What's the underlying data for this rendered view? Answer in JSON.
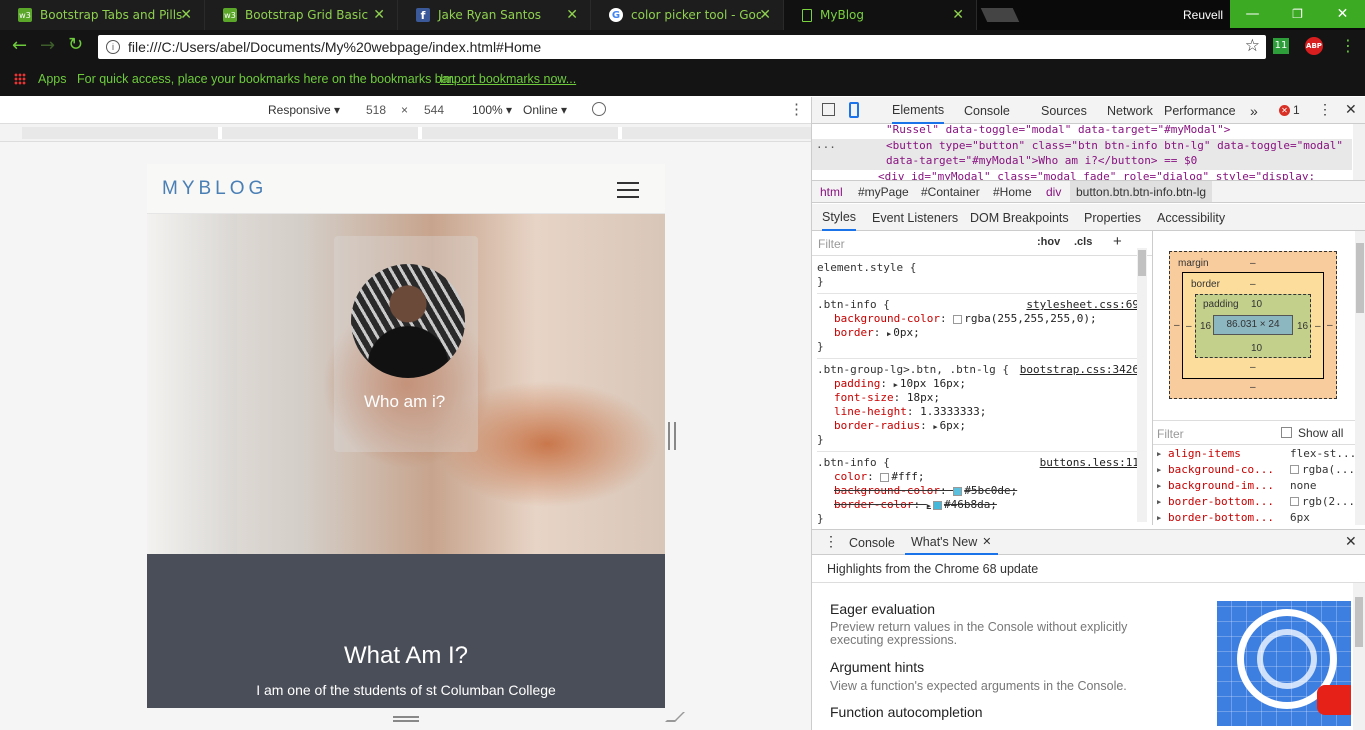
{
  "browser": {
    "tabs": [
      {
        "title": "Bootstrap Tabs and Pills",
        "icon": "w3schools-icon",
        "color": "#5aa72a"
      },
      {
        "title": "Bootstrap Grid Basic",
        "icon": "w3schools-icon",
        "color": "#5aa72a"
      },
      {
        "title": "Jake Ryan Santos",
        "icon": "facebook-icon",
        "color": "#3b5998"
      },
      {
        "title": "color picker tool - Google",
        "icon": "google-icon",
        "color": "#ffffff"
      },
      {
        "title": "MyBlog",
        "icon": "page-icon",
        "color": "#7ad23e"
      }
    ],
    "user": "Reuvell",
    "url": "file:///C:/Users/abel/Documents/My%20webpage/index.html#Home",
    "bookmarks": {
      "apps": "Apps",
      "hint": "For quick access, place your bookmarks here on the bookmarks bar.",
      "import_link": "Import bookmarks now..."
    },
    "abp": "ABP",
    "ext11": "11"
  },
  "device_toolbar": {
    "mode": "Responsive",
    "width": "518",
    "x": "×",
    "height": "544",
    "zoom": "100%",
    "network": "Online"
  },
  "site": {
    "brand": "MYBLOG",
    "hero_button": "Who am i?",
    "section_title": "What Am I?",
    "section_text": "I am one of the students of st Columban College"
  },
  "devtools": {
    "tabs": [
      "Elements",
      "Console",
      "Sources",
      "Network",
      "Performance"
    ],
    "more": "»",
    "error_count": "1",
    "dom_lines": [
      "\"Russel\" data-toggle=\"modal\" data-target=\"#myModal\">",
      "<button type=\"button\" class=\"btn btn-info btn-lg\" data-toggle=\"modal\"",
      "data-target=\"#myModal\">Who am i?</button> == $0",
      "<div id=\"myModal\" class=\"modal fade\" role=\"dialog\" style=\"display:"
    ],
    "dom_ellipsis": "...",
    "breadcrumb": [
      "html",
      "#myPage",
      "#Container",
      "#Home",
      "div",
      "button.btn.btn-info.btn-lg"
    ],
    "style_tabs": [
      "Styles",
      "Event Listeners",
      "DOM Breakpoints",
      "Properties",
      "Accessibility"
    ],
    "filter_placeholder": "Filter",
    "hov": ":hov",
    "cls": ".cls",
    "rules": [
      {
        "selector": "element.style {",
        "source": "",
        "decls": []
      },
      {
        "selector": ".btn-info {",
        "source": "stylesheet.css:69",
        "decls": [
          {
            "prop": "background-color",
            "val": "rgba(255,255,255,0);",
            "swatch": "#ffffff",
            "strike": false
          },
          {
            "prop": "border",
            "val": "0px;",
            "swatch": "",
            "strike": false,
            "arrow": true
          }
        ]
      },
      {
        "selector": ".btn-group-lg>.btn, .btn-lg {",
        "source": "bootstrap.css:3426",
        "decls": [
          {
            "prop": "padding",
            "val": "10px 16px;",
            "swatch": "",
            "strike": false,
            "arrow": true
          },
          {
            "prop": "font-size",
            "val": "18px;",
            "swatch": "",
            "strike": false
          },
          {
            "prop": "line-height",
            "val": "1.3333333;",
            "swatch": "",
            "strike": false
          },
          {
            "prop": "border-radius",
            "val": "6px;",
            "swatch": "",
            "strike": false,
            "arrow": true
          }
        ]
      },
      {
        "selector": ".btn-info {",
        "source": "buttons.less:11",
        "decls": [
          {
            "prop": "color",
            "val": "#fff;",
            "swatch": "#ffffff",
            "strike": false
          },
          {
            "prop": "background-color",
            "val": "#5bc0de;",
            "swatch": "#5bc0de",
            "strike": true
          },
          {
            "prop": "border-color",
            "val": "#46b8da;",
            "swatch": "#46b8da",
            "strike": true,
            "arrow": true
          }
        ]
      }
    ],
    "close_brace": "}",
    "box_model": {
      "margin": "margin",
      "margin_val": "–",
      "border": "border",
      "border_val": "–",
      "padding": "padding",
      "padding_val": "10",
      "content": "86.031 × 24",
      "left": "16",
      "right": "16",
      "bottom_pad": "10",
      "outer_left": "–",
      "outer_right": "–",
      "b_left": "–",
      "b_right": "–",
      "b_bottom": "–",
      "m_bottom": "–"
    },
    "computed_filter": "Filter",
    "show_all": "Show all",
    "computed": [
      {
        "prop": "align-items",
        "val": "flex-st...",
        "swatch": ""
      },
      {
        "prop": "background-co...",
        "val": "rgba(...",
        "swatch": "#ffffff"
      },
      {
        "prop": "background-im...",
        "val": "none",
        "swatch": ""
      },
      {
        "prop": "border-bottom...",
        "val": "rgb(2...",
        "swatch": "#ffffff"
      },
      {
        "prop": "border-bottom...",
        "val": "6px",
        "swatch": ""
      }
    ],
    "drawer_tabs": [
      "Console",
      "What's New"
    ],
    "whats_new_header": "Highlights from the Chrome 68 update",
    "features": [
      {
        "title": "Eager evaluation",
        "desc": "Preview return values in the Console without explicitly executing expressions."
      },
      {
        "title": "Argument hints",
        "desc": "View a function's expected arguments in the Console."
      },
      {
        "title": "Function autocompletion",
        "desc": ""
      }
    ]
  }
}
